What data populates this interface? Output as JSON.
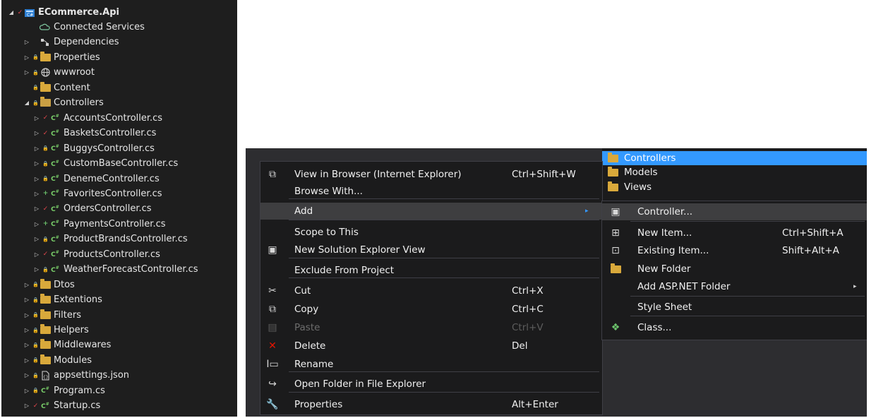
{
  "solution_explorer": {
    "project": "ECommerce.Api",
    "nodes": [
      {
        "label": "Connected Services",
        "arrow": "",
        "status": "",
        "icon": "connected-services-icon"
      },
      {
        "label": "Dependencies",
        "arrow": "▷",
        "status": "",
        "icon": "dependencies-icon"
      },
      {
        "label": "Properties",
        "arrow": "▷",
        "status": "lock",
        "icon": "properties-folder-icon"
      },
      {
        "label": "wwwroot",
        "arrow": "▷",
        "status": "lock",
        "icon": "globe-icon"
      },
      {
        "label": "Content",
        "arrow": "",
        "status": "lock",
        "icon": "folder-icon"
      },
      {
        "label": "Controllers",
        "arrow": "◢",
        "status": "lock",
        "icon": "open-folder-icon"
      },
      {
        "label": "AccountsController.cs",
        "arrow": "▷",
        "status": "check",
        "icon": "csharp-file-icon"
      },
      {
        "label": "BasketsController.cs",
        "arrow": "▷",
        "status": "check",
        "icon": "csharp-file-icon"
      },
      {
        "label": "BuggysController.cs",
        "arrow": "▷",
        "status": "lock",
        "icon": "csharp-file-icon"
      },
      {
        "label": "CustomBaseController.cs",
        "arrow": "▷",
        "status": "lock",
        "icon": "csharp-file-icon"
      },
      {
        "label": "DenemeController.cs",
        "arrow": "▷",
        "status": "lock",
        "icon": "csharp-file-icon"
      },
      {
        "label": "FavoritesController.cs",
        "arrow": "▷",
        "status": "plus",
        "icon": "csharp-file-icon"
      },
      {
        "label": "OrdersController.cs",
        "arrow": "▷",
        "status": "check",
        "icon": "csharp-file-icon"
      },
      {
        "label": "PaymentsController.cs",
        "arrow": "▷",
        "status": "plus",
        "icon": "csharp-file-icon"
      },
      {
        "label": "ProductBrandsController.cs",
        "arrow": "▷",
        "status": "lock",
        "icon": "csharp-file-icon"
      },
      {
        "label": "ProductsController.cs",
        "arrow": "▷",
        "status": "check",
        "icon": "csharp-file-icon"
      },
      {
        "label": "WeatherForecastController.cs",
        "arrow": "▷",
        "status": "lock",
        "icon": "csharp-file-icon"
      },
      {
        "label": "Dtos",
        "arrow": "▷",
        "status": "lock",
        "icon": "folder-icon"
      },
      {
        "label": "Extentions",
        "arrow": "▷",
        "status": "lock",
        "icon": "folder-icon"
      },
      {
        "label": "Filters",
        "arrow": "▷",
        "status": "lock",
        "icon": "folder-icon"
      },
      {
        "label": "Helpers",
        "arrow": "▷",
        "status": "lock",
        "icon": "folder-icon"
      },
      {
        "label": "Middlewares",
        "arrow": "▷",
        "status": "lock",
        "icon": "folder-icon"
      },
      {
        "label": "Modules",
        "arrow": "▷",
        "status": "lock",
        "icon": "folder-icon"
      },
      {
        "label": "appsettings.json",
        "arrow": "▷",
        "status": "lock",
        "icon": "json-file-icon"
      },
      {
        "label": "Program.cs",
        "arrow": "▷",
        "status": "lock",
        "icon": "csharp-file-icon"
      },
      {
        "label": "Startup.cs",
        "arrow": "▷",
        "status": "check",
        "icon": "csharp-file-icon"
      }
    ]
  },
  "folder_popup": {
    "items": [
      "Controllers",
      "Models",
      "Views"
    ],
    "selected": "Controllers"
  },
  "context_menu": {
    "items": [
      {
        "label": "View in Browser (Internet Explorer)",
        "shortcut": "Ctrl+Shift+W",
        "icon": "browser-view-icon"
      },
      {
        "label": "Browse With...",
        "shortcut": "",
        "icon": ""
      },
      {
        "label": "Add",
        "shortcut": "",
        "icon": "",
        "submenu": true
      },
      {
        "label": "Scope to This",
        "shortcut": "",
        "icon": ""
      },
      {
        "label": "New Solution Explorer View",
        "shortcut": "",
        "icon": "new-view-icon"
      },
      {
        "label": "Exclude From Project",
        "shortcut": "",
        "icon": ""
      },
      {
        "label": "Cut",
        "shortcut": "Ctrl+X",
        "icon": "scissors-icon"
      },
      {
        "label": "Copy",
        "shortcut": "Ctrl+C",
        "icon": "copy-icon"
      },
      {
        "label": "Paste",
        "shortcut": "Ctrl+V",
        "icon": "paste-icon",
        "disabled": true
      },
      {
        "label": "Delete",
        "shortcut": "Del",
        "icon": "delete-x-icon"
      },
      {
        "label": "Rename",
        "shortcut": "",
        "icon": "rename-icon"
      },
      {
        "label": "Open Folder in File Explorer",
        "shortcut": "",
        "icon": "open-folder-arrow-icon"
      },
      {
        "label": "Properties",
        "shortcut": "Alt+Enter",
        "icon": "wrench-icon"
      }
    ]
  },
  "add_submenu": {
    "items": [
      {
        "label": "Controller...",
        "shortcut": "",
        "icon": "controller-icon"
      },
      {
        "label": "New Item...",
        "shortcut": "Ctrl+Shift+A",
        "icon": "new-item-icon"
      },
      {
        "label": "Existing Item...",
        "shortcut": "Shift+Alt+A",
        "icon": "existing-item-icon"
      },
      {
        "label": "New Folder",
        "shortcut": "",
        "icon": "new-folder-icon"
      },
      {
        "label": "Add ASP.NET Folder",
        "shortcut": "",
        "icon": "",
        "submenu": true
      },
      {
        "label": "Style Sheet",
        "shortcut": "",
        "icon": ""
      },
      {
        "label": "Class...",
        "shortcut": "",
        "icon": "class-icon"
      }
    ]
  },
  "colors": {
    "explorer_bg": "#1e1e1e",
    "menu_bg": "#1b1b1c",
    "selection_blue": "#3399ff",
    "folder": "#d9a93b",
    "check_red": "#e5484d",
    "lock_blue": "#3b8ad9",
    "plus_green": "#6cc36c"
  }
}
